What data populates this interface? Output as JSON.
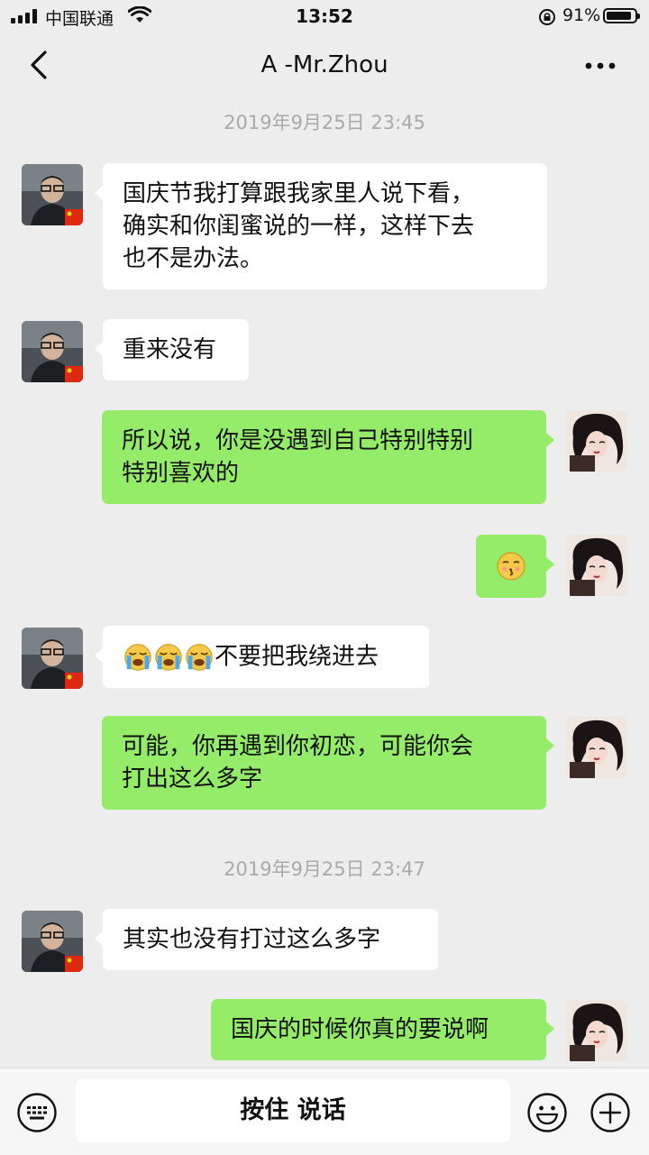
{
  "status": {
    "carrier": "中国联通",
    "time": "13:52",
    "battery": "91%",
    "battery_level": 0.91
  },
  "header": {
    "title": "A -Mr.Zhou"
  },
  "timestamps": [
    "2019年9月25日 23:45",
    "2019年9月25日 23:47"
  ],
  "messages": [
    {
      "side": "in",
      "lines": [
        "国庆节我打算跟我家里人说下看，",
        "确实和你闺蜜说的一样，这样下去",
        "也不是办法。"
      ]
    },
    {
      "side": "in",
      "lines": [
        "重来没有"
      ]
    },
    {
      "side": "out",
      "lines": [
        "所以说，你是没遇到自己特别特别",
        "特别喜欢的"
      ]
    },
    {
      "side": "out",
      "emoji": "kissing-face"
    },
    {
      "side": "in",
      "emoji": [
        "loudly-crying-face",
        "loudly-crying-face",
        "loudly-crying-face"
      ],
      "text": "不要把我绕进去"
    },
    {
      "side": "out",
      "lines": [
        "可能，你再遇到你初恋，可能你会",
        "打出这么多字"
      ]
    },
    {
      "side": "in",
      "lines": [
        "其实也没有打过这么多字"
      ]
    },
    {
      "side": "out",
      "lines": [
        "国庆的时候你真的要说啊"
      ]
    }
  ],
  "input": {
    "hold_to_talk": "按住 说话"
  },
  "icons": [
    "signal-icon",
    "wifi-icon",
    "rotation-lock-icon",
    "battery-icon",
    "back-icon",
    "more-icon",
    "keyboard-icon",
    "emoji-icon",
    "plus-icon"
  ]
}
